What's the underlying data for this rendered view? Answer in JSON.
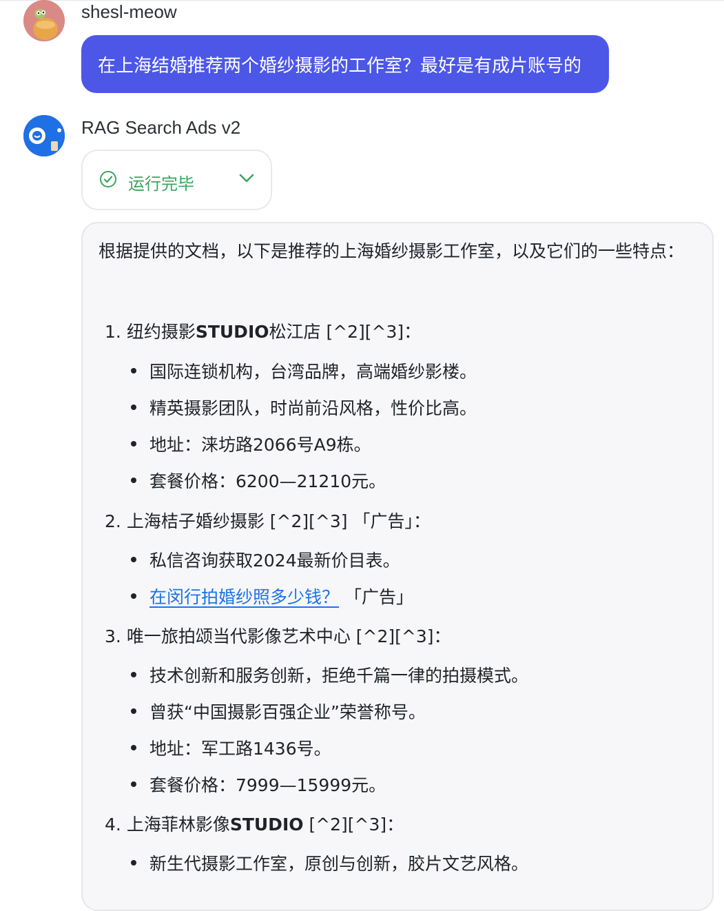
{
  "user": {
    "name": "shesl-meow",
    "message": "在上海结婚推荐两个婚纱摄影的工作室？最好是有成片账号的"
  },
  "bot": {
    "name": "RAG Search Ads v2",
    "status": "运行完毕",
    "intro": "根据提供的文档，以下是推荐的上海婚纱摄影工作室，以及它们的一些特点：",
    "sections": [
      {
        "num": "1.",
        "title_prefix": "纽约摄影",
        "title_bold": "STUDIO",
        "title_suffix": "松江店 [^2][^3]：",
        "bullets": [
          "国际连锁机构，台湾品牌，高端婚纱影楼。",
          "精英摄影团队，时尚前沿风格，性价比高。",
          "地址：涞坊路2066号A9栋。",
          "套餐价格：6200—21210元。"
        ]
      },
      {
        "num": "2.",
        "title_prefix": "上海桔子婚纱摄影",
        "title_bold": "",
        "title_suffix": " [^2][^3] 「广告」：",
        "bullets": [
          "私信咨询获取2024最新价目表。"
        ],
        "link_bullet": {
          "link_text": "在闵行拍婚纱照多少钱？",
          "suffix": " 「广告」"
        }
      },
      {
        "num": "3.",
        "title_prefix": "唯一旅拍颂当代影像艺术中心",
        "title_bold": "",
        "title_suffix": " [^2][^3]：",
        "bullets": [
          "技术创新和服务创新，拒绝千篇一律的拍摄模式。",
          "曾获“中国摄影百强企业”荣誉称号。",
          "地址：军工路1436号。",
          "套餐价格：7999—15999元。"
        ]
      },
      {
        "num": "4.",
        "title_prefix": "上海菲林影像",
        "title_bold": "STUDIO",
        "title_suffix": " [^2][^3]：",
        "bullets": [
          "新生代摄影工作室，原创与创新，胶片文艺风格。"
        ]
      }
    ]
  },
  "colors": {
    "user_bubble": "#4c57e8",
    "status_green": "#3aa55d",
    "link_blue": "#1a73e8",
    "card_bg": "#f7f7f9"
  },
  "icons": {
    "status": "check-circle-icon",
    "expand": "chevron-down-icon"
  }
}
